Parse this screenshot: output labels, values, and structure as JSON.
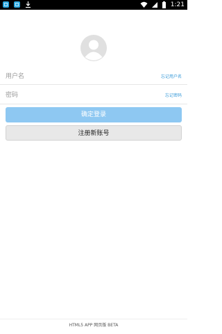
{
  "status_bar": {
    "time": "1:21",
    "icons": [
      "notification-icon",
      "notification-icon",
      "download-icon",
      "wifi-icon",
      "signal-icon",
      "battery-icon"
    ]
  },
  "avatar": {
    "icon": "user-avatar-icon"
  },
  "login_form": {
    "username": {
      "placeholder": "用户名",
      "value": "",
      "link_label": "忘记用户名"
    },
    "password": {
      "placeholder": "密码",
      "value": "",
      "link_label": "忘记密码"
    },
    "login_button_label": "确定登录",
    "register_button_label": "注册新账号"
  },
  "footer": {
    "text": "HTML5 APP 网页版 BETA"
  },
  "colors": {
    "accent": "#3a9bd9",
    "login_button": "#8ec8f2",
    "register_button": "#e8e8e8",
    "status_bar": "#000000",
    "avatar": "#e0e0e0"
  }
}
